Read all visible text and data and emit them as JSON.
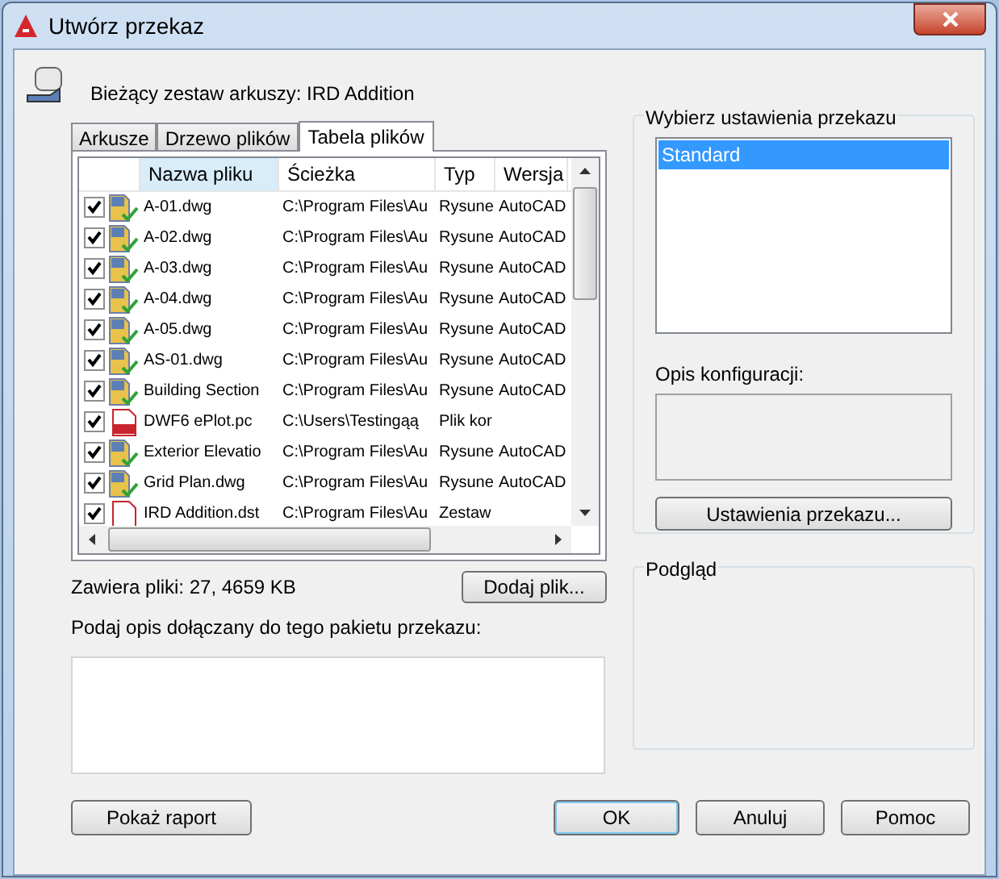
{
  "window": {
    "title": "Utwórz przekaz"
  },
  "sheet_set": {
    "label": "Bieżący zestaw arkuszy: IRD Addition"
  },
  "tabs": [
    {
      "label": "Arkusze",
      "selected": false
    },
    {
      "label": "Drzewo plików",
      "selected": false
    },
    {
      "label": "Tabela plików",
      "selected": true
    }
  ],
  "table": {
    "columns": [
      "Nazwa pliku",
      "Ścieżka",
      "Typ",
      "Wersja"
    ],
    "rows": [
      {
        "kind": "drawing",
        "checked": true,
        "cells": [
          "A-01.dwg",
          "C:\\Program Files\\Au",
          "Rysune",
          "AutoCAD"
        ]
      },
      {
        "kind": "drawing",
        "checked": true,
        "cells": [
          "A-02.dwg",
          "C:\\Program Files\\Au",
          "Rysune",
          "AutoCAD"
        ]
      },
      {
        "kind": "drawing",
        "checked": true,
        "cells": [
          "A-03.dwg",
          "C:\\Program Files\\Au",
          "Rysune",
          "AutoCAD"
        ]
      },
      {
        "kind": "drawing",
        "checked": true,
        "cells": [
          "A-04.dwg",
          "C:\\Program Files\\Au",
          "Rysune",
          "AutoCAD"
        ]
      },
      {
        "kind": "drawing",
        "checked": true,
        "cells": [
          "A-05.dwg",
          "C:\\Program Files\\Au",
          "Rysune",
          "AutoCAD"
        ]
      },
      {
        "kind": "drawing",
        "checked": true,
        "cells": [
          "AS-01.dwg",
          "C:\\Program Files\\Au",
          "Rysune",
          "AutoCAD"
        ]
      },
      {
        "kind": "drawing",
        "checked": true,
        "cells": [
          "Building Section",
          "C:\\Program Files\\Au",
          "Rysune",
          "AutoCAD"
        ]
      },
      {
        "kind": "plot-config",
        "checked": true,
        "cells": [
          "DWF6 ePlot.pc",
          "C:\\Users\\Testingąą",
          "Plik kor",
          ""
        ]
      },
      {
        "kind": "drawing",
        "checked": true,
        "cells": [
          "Exterior Elevatio",
          "C:\\Program Files\\Au",
          "Rysune",
          "AutoCAD"
        ]
      },
      {
        "kind": "drawing",
        "checked": true,
        "cells": [
          "Grid Plan.dwg",
          "C:\\Program Files\\Au",
          "Rysune",
          "AutoCAD"
        ]
      },
      {
        "kind": "sheet-set",
        "checked": true,
        "cells": [
          "IRD Addition.dst",
          "C:\\Program Files\\Au",
          "Zestaw",
          ""
        ]
      }
    ]
  },
  "summary": "Zawiera pliki: 27, 4659 KB",
  "add_file_button": "Dodaj plik...",
  "description": {
    "label": "Podaj opis dołączany do tego pakietu przekazu:"
  },
  "settings_group": {
    "title": "Wybierz ustawienia przekazu",
    "items": [
      {
        "label": "Standard",
        "selected": true
      }
    ],
    "config_label": "Opis konfiguracji:",
    "button": "Ustawienia przekazu..."
  },
  "preview_group": {
    "title": "Podgląd"
  },
  "buttons": [
    {
      "label": "Pokaż raport",
      "kind": "secondary"
    },
    {
      "label": "OK",
      "kind": "default"
    },
    {
      "label": "Anuluj",
      "kind": "secondary"
    },
    {
      "label": "Pomoc",
      "kind": "secondary"
    }
  ]
}
